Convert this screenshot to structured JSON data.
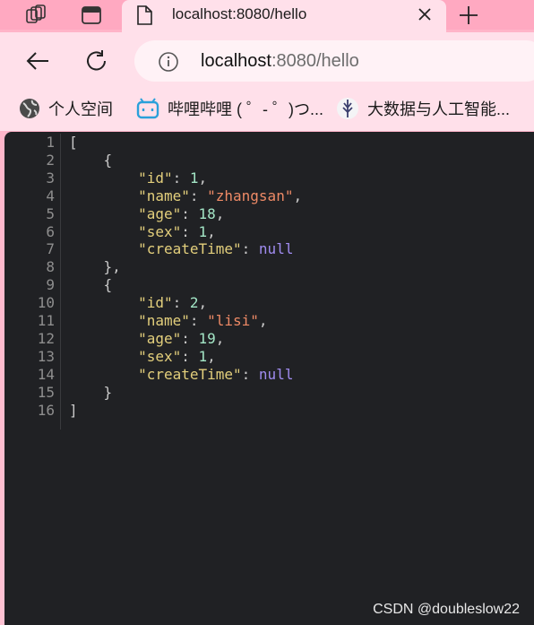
{
  "tab": {
    "title": "localhost:8080/hello",
    "favicon": "page-icon"
  },
  "toolbar": {
    "url_host": "localhost",
    "url_rest": ":8080/hello"
  },
  "bookmarks": [
    {
      "label": "个人空间",
      "icon": "globe-icon"
    },
    {
      "label": "哔哩哔哩 ( ゜- ゜)つ...",
      "icon": "bilibili-icon"
    },
    {
      "label": "大数据与人工智能...",
      "icon": "feather-icon"
    }
  ],
  "json_viewer": {
    "line_numbers": [
      "1",
      "2",
      "3",
      "4",
      "5",
      "6",
      "7",
      "8",
      "9",
      "10",
      "11",
      "12",
      "13",
      "14",
      "15",
      "16"
    ],
    "lines": [
      [
        {
          "t": "[",
          "c": "p"
        }
      ],
      [
        {
          "t": "    {",
          "c": "p"
        }
      ],
      [
        {
          "t": "        ",
          "c": "p"
        },
        {
          "t": "\"id\"",
          "c": "k"
        },
        {
          "t": ": ",
          "c": "p"
        },
        {
          "t": "1",
          "c": "n"
        },
        {
          "t": ",",
          "c": "p"
        }
      ],
      [
        {
          "t": "        ",
          "c": "p"
        },
        {
          "t": "\"name\"",
          "c": "k"
        },
        {
          "t": ": ",
          "c": "p"
        },
        {
          "t": "\"zhangsan\"",
          "c": "s"
        },
        {
          "t": ",",
          "c": "p"
        }
      ],
      [
        {
          "t": "        ",
          "c": "p"
        },
        {
          "t": "\"age\"",
          "c": "k"
        },
        {
          "t": ": ",
          "c": "p"
        },
        {
          "t": "18",
          "c": "n"
        },
        {
          "t": ",",
          "c": "p"
        }
      ],
      [
        {
          "t": "        ",
          "c": "p"
        },
        {
          "t": "\"sex\"",
          "c": "k"
        },
        {
          "t": ": ",
          "c": "p"
        },
        {
          "t": "1",
          "c": "n"
        },
        {
          "t": ",",
          "c": "p"
        }
      ],
      [
        {
          "t": "        ",
          "c": "p"
        },
        {
          "t": "\"createTime\"",
          "c": "k"
        },
        {
          "t": ": ",
          "c": "p"
        },
        {
          "t": "null",
          "c": "nl"
        }
      ],
      [
        {
          "t": "    },",
          "c": "p"
        }
      ],
      [
        {
          "t": "    {",
          "c": "p"
        }
      ],
      [
        {
          "t": "        ",
          "c": "p"
        },
        {
          "t": "\"id\"",
          "c": "k"
        },
        {
          "t": ": ",
          "c": "p"
        },
        {
          "t": "2",
          "c": "n"
        },
        {
          "t": ",",
          "c": "p"
        }
      ],
      [
        {
          "t": "        ",
          "c": "p"
        },
        {
          "t": "\"name\"",
          "c": "k"
        },
        {
          "t": ": ",
          "c": "p"
        },
        {
          "t": "\"lisi\"",
          "c": "s"
        },
        {
          "t": ",",
          "c": "p"
        }
      ],
      [
        {
          "t": "        ",
          "c": "p"
        },
        {
          "t": "\"age\"",
          "c": "k"
        },
        {
          "t": ": ",
          "c": "p"
        },
        {
          "t": "19",
          "c": "n"
        },
        {
          "t": ",",
          "c": "p"
        }
      ],
      [
        {
          "t": "        ",
          "c": "p"
        },
        {
          "t": "\"sex\"",
          "c": "k"
        },
        {
          "t": ": ",
          "c": "p"
        },
        {
          "t": "1",
          "c": "n"
        },
        {
          "t": ",",
          "c": "p"
        }
      ],
      [
        {
          "t": "        ",
          "c": "p"
        },
        {
          "t": "\"createTime\"",
          "c": "k"
        },
        {
          "t": ": ",
          "c": "p"
        },
        {
          "t": "null",
          "c": "nl"
        }
      ],
      [
        {
          "t": "    }",
          "c": "p"
        }
      ],
      [
        {
          "t": "]",
          "c": "p"
        }
      ]
    ]
  },
  "watermark": "CSDN @doubleslow22",
  "colors": {
    "tabstrip": "#ffa9c1",
    "toolbar": "#ffe0ea",
    "viewer_bg": "#202124",
    "key": "#e3cf7c",
    "string": "#ee8a66",
    "number": "#a3e6c6",
    "null": "#a08cf0"
  }
}
